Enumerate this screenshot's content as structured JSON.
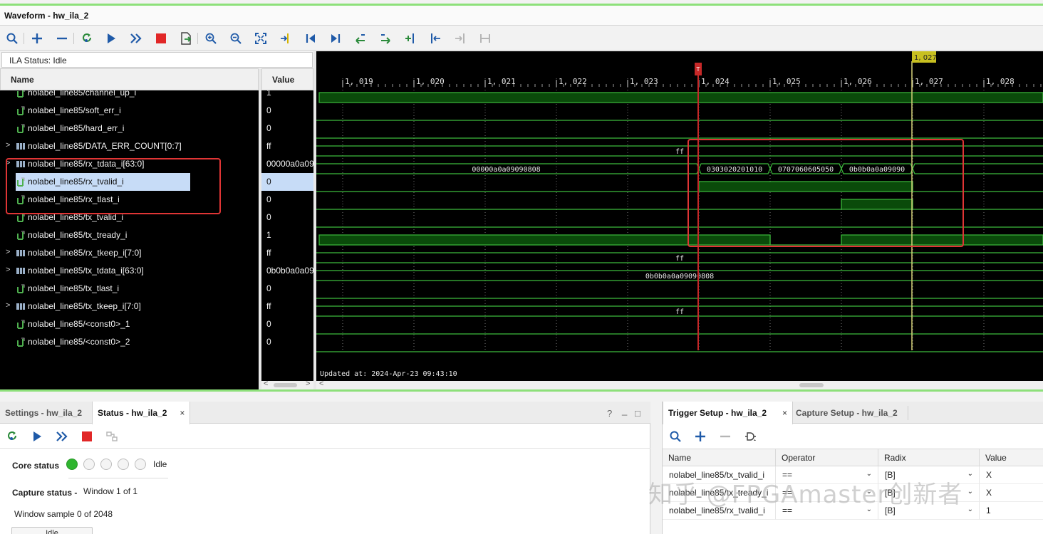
{
  "window": {
    "title": "Waveform - hw_ila_2"
  },
  "ila_status": "ILA Status:  Idle",
  "headers": {
    "name": "Name",
    "value": "Value"
  },
  "signals": [
    {
      "name": "nolabel_line85/channel_up_i",
      "value": "1",
      "bus": false
    },
    {
      "name": "nolabel_line85/soft_err_i",
      "value": "0",
      "bus": false
    },
    {
      "name": "nolabel_line85/hard_err_i",
      "value": "0",
      "bus": false
    },
    {
      "name": "nolabel_line85/DATA_ERR_COUNT[0:7]",
      "value": "ff",
      "bus": true
    },
    {
      "name": "nolabel_line85/rx_tdata_i[63:0]",
      "value": "00000a0a09",
      "bus": true
    },
    {
      "name": "nolabel_line85/rx_tvalid_i",
      "value": "0",
      "bus": false,
      "selected": true
    },
    {
      "name": "nolabel_line85/rx_tlast_i",
      "value": "0",
      "bus": false
    },
    {
      "name": "nolabel_line85/tx_tvalid_i",
      "value": "0",
      "bus": false
    },
    {
      "name": "nolabel_line85/tx_tready_i",
      "value": "1",
      "bus": false
    },
    {
      "name": "nolabel_line85/rx_tkeep_i[7:0]",
      "value": "ff",
      "bus": true
    },
    {
      "name": "nolabel_line85/tx_tdata_i[63:0]",
      "value": "0b0b0a0a09",
      "bus": true
    },
    {
      "name": "nolabel_line85/tx_tlast_i",
      "value": "0",
      "bus": false
    },
    {
      "name": "nolabel_line85/tx_tkeep_i[7:0]",
      "value": "ff",
      "bus": true
    },
    {
      "name": "nolabel_line85/<const0>_1",
      "value": "0",
      "bus": false
    },
    {
      "name": "nolabel_line85/<const0>_2",
      "value": "0",
      "bus": false
    }
  ],
  "timeline": {
    "ticks": [
      "1, 019",
      "1, 020",
      "1, 021",
      "1, 022",
      "1, 023",
      "1, 024",
      "1, 025",
      "1, 026",
      "1, 027",
      "1, 028"
    ],
    "trigger_marker": "T",
    "cursor_label": "1, 027",
    "updated": "Updated at: 2024-Apr-23 09:43:10"
  },
  "wave_labels": {
    "data_err_count": "ff",
    "rx_tdata_a": "00000a0a09090808",
    "rx_tdata_b": "0303020201010",
    "rx_tdata_c": "0707060605050",
    "rx_tdata_d": "0b0b0a0a09090",
    "rx_tkeep": "ff",
    "tx_tdata": "0b0b0a0a09090808",
    "tx_tkeep": "ff"
  },
  "colors": {
    "wave": "#3dbb3d",
    "wave_fill": "#0a4a0a",
    "trigger": "#c62828",
    "cursor": "#d7d27a",
    "highlight": "#e03535",
    "selection": "#c7dcf7"
  },
  "status_panel": {
    "tabs": [
      "Settings - hw_ila_2",
      "Status - hw_ila_2"
    ],
    "active_tab": "Status - hw_ila_2",
    "close": "×",
    "help": "?",
    "minimize": "_",
    "maximize": "□",
    "core_status_label": "Core status",
    "core_state": "Idle",
    "capture_status_label": "Capture status -",
    "capture_window": "Window 1 of 1",
    "window_sample": "Window sample 0 of 2048",
    "button_stub": "Idle"
  },
  "trigger_panel": {
    "tabs": [
      "Trigger Setup - hw_ila_2",
      "Capture Setup - hw_ila_2"
    ],
    "close": "×",
    "columns": [
      "Name",
      "Operator",
      "Radix",
      "Value"
    ],
    "rows": [
      {
        "name": "nolabel_line85/tx_tvalid_i",
        "operator": "==",
        "radix": "[B]",
        "value": "X"
      },
      {
        "name": "nolabel_line85/tx_tready_i",
        "operator": "==",
        "radix": "[B]",
        "value": "X"
      },
      {
        "name": "nolabel_line85/rx_tvalid_i",
        "operator": "==",
        "radix": "[B]",
        "value": "1"
      }
    ]
  },
  "watermark": "知乎 @FPGAmaster创新者"
}
